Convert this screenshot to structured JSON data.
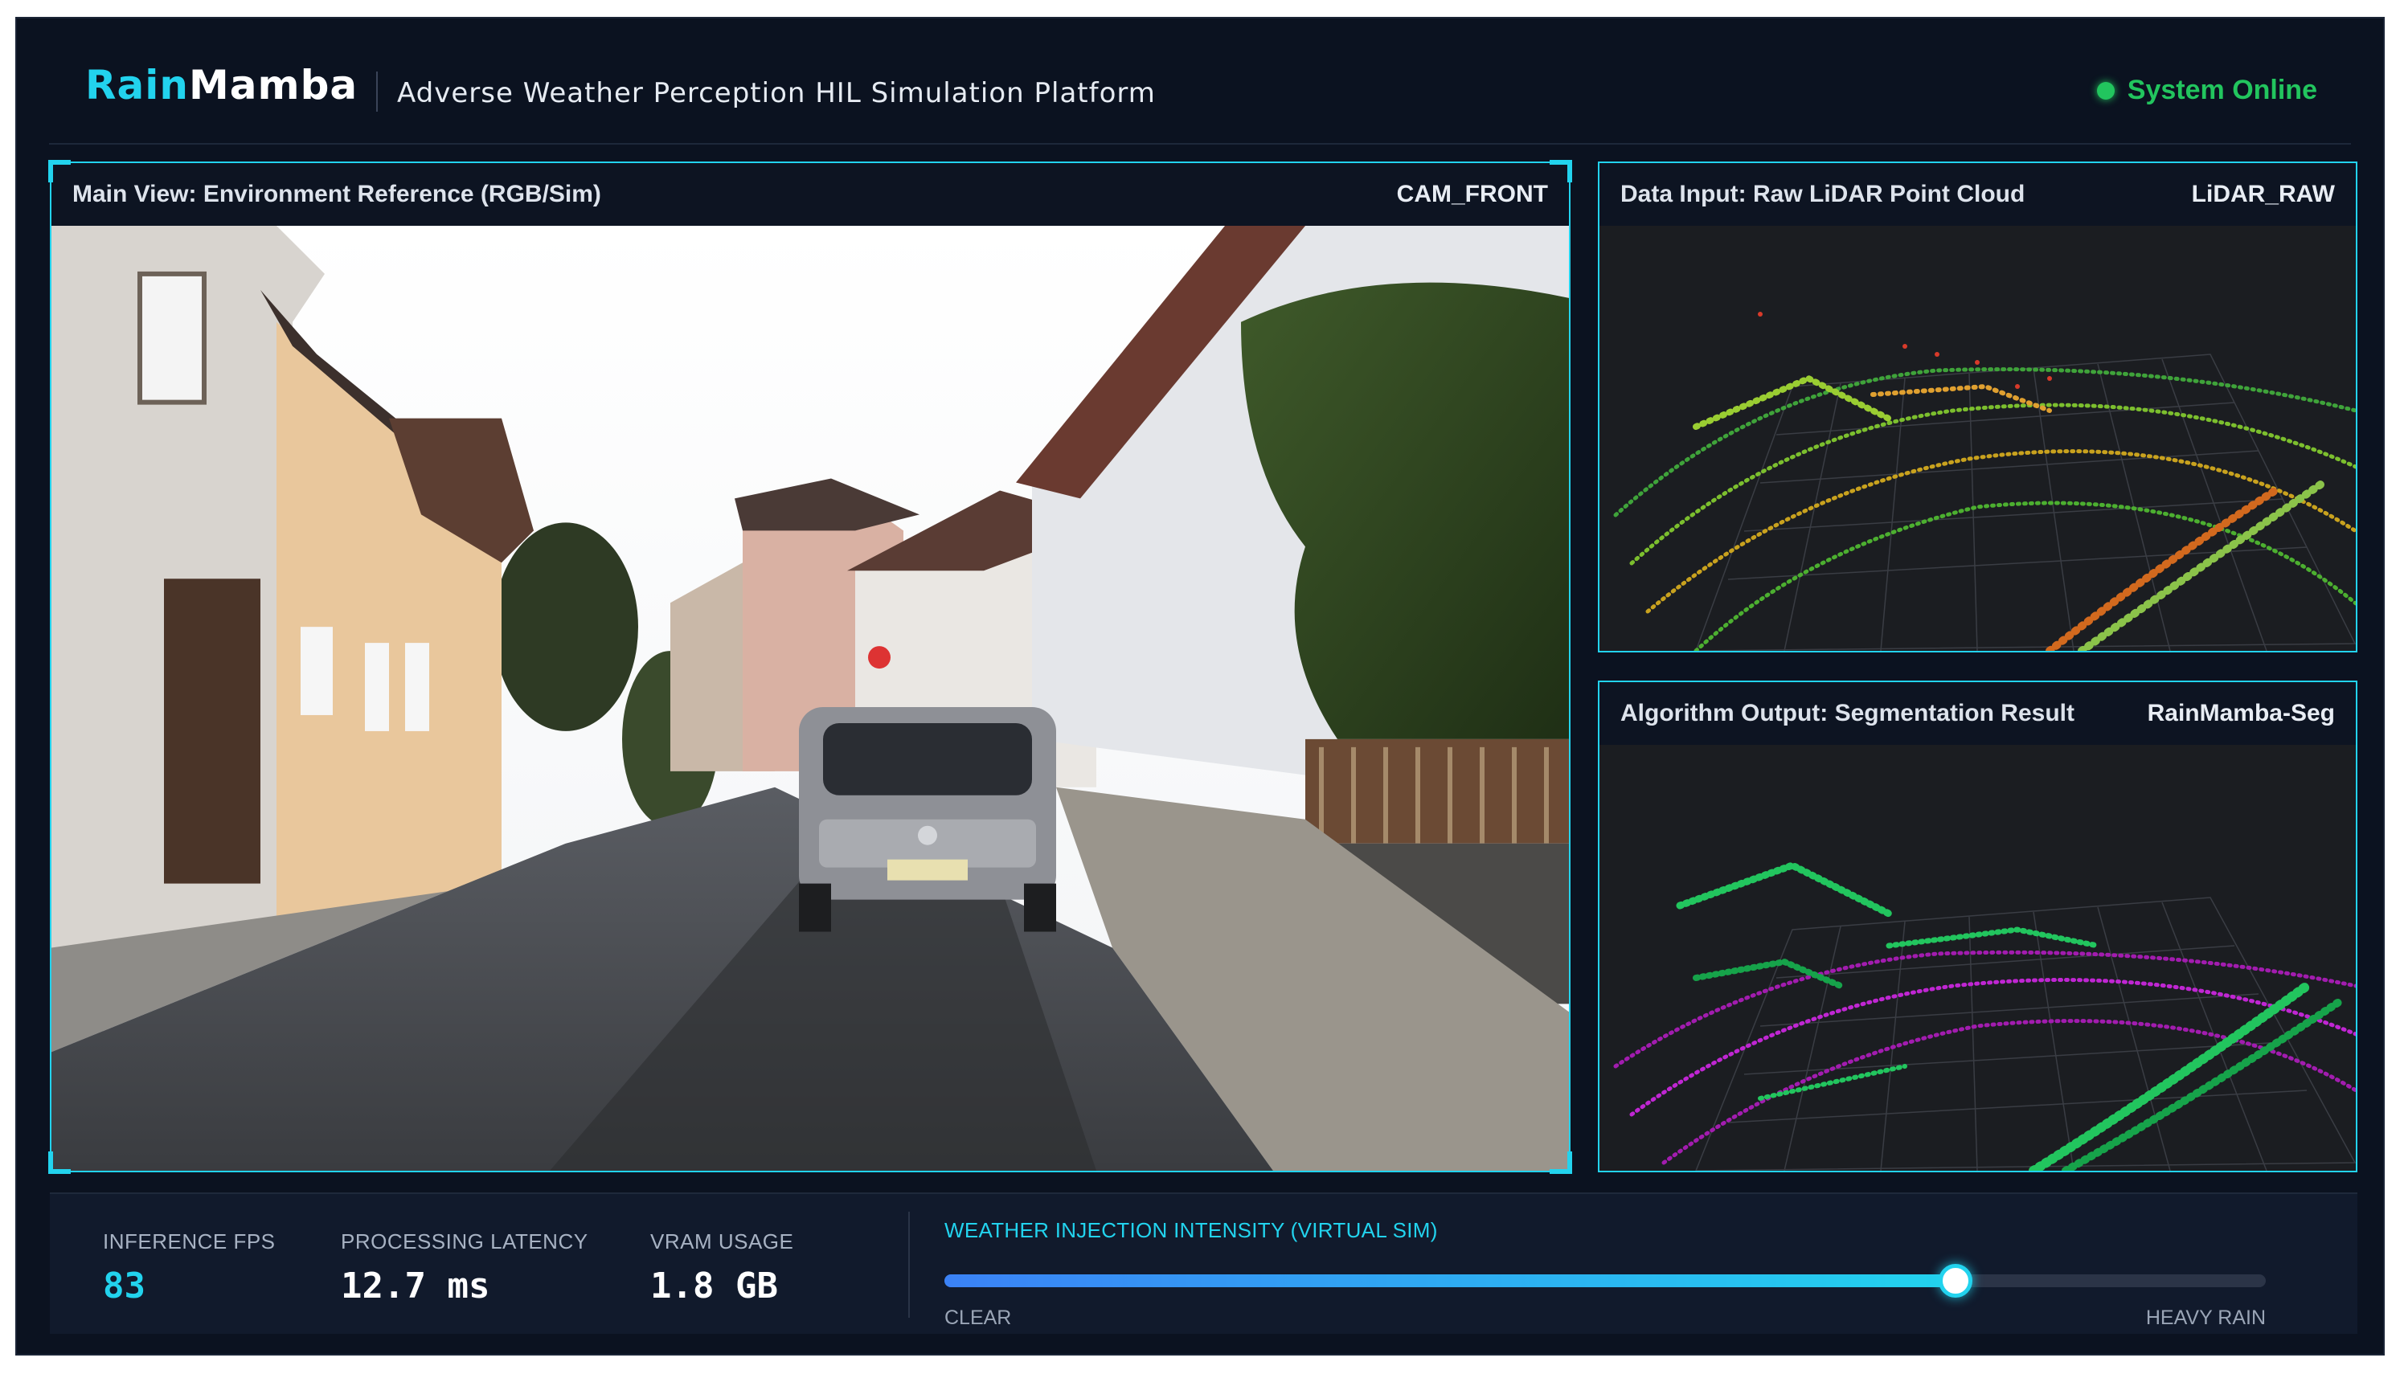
{
  "header": {
    "brand_part1": "Rain",
    "brand_part2": "Mamba",
    "subtitle": "Adverse Weather Perception HIL Simulation Platform",
    "status_label": "System Online"
  },
  "panels": {
    "main": {
      "title": "Main View: Environment Reference (RGB/Sim)",
      "tag": "CAM_FRONT"
    },
    "lidar": {
      "title": "Data Input: Raw LiDAR Point Cloud",
      "tag": "LiDAR_RAW"
    },
    "segmentation": {
      "title": "Algorithm Output: Segmentation Result",
      "tag": "RainMamba-Seg"
    }
  },
  "metrics": {
    "fps_label": "Inference FPS",
    "fps_value": "83",
    "latency_label": "Processing Latency",
    "latency_value": "12.7 ms",
    "vram_label": "VRAM Usage",
    "vram_value": "1.8 GB"
  },
  "weather_slider": {
    "label": "Weather Injection Intensity (Virtual Sim)",
    "min_label": "CLEAR",
    "max_label": "HEAVY RAIN",
    "value_fraction": 0.765
  },
  "colors": {
    "accent": "#22d3ee",
    "status": "#22c55e",
    "background": "#0b1220",
    "seg_road": "#c026d3",
    "seg_object": "#22c55e"
  }
}
